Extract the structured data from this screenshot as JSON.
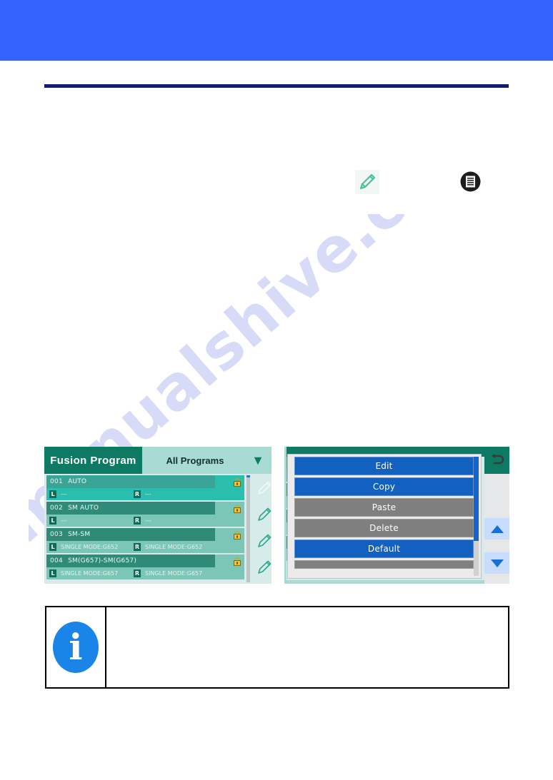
{
  "page": {
    "banner_color": "#3563fb",
    "rule_color": "#151a6e",
    "watermark": "manualshive.com"
  },
  "doc_icons": {
    "pencil": "pencil-edit-icon",
    "list": "list-document-icon"
  },
  "left_screen": {
    "title": "Fusion Program",
    "filter_label": "All Programs",
    "chevron": "▼",
    "back_icon": "back-arrow-icon",
    "scroll_up_icon": "▲",
    "scroll_down_icon": "▼",
    "rows": [
      {
        "number": "001",
        "name": "AUTO",
        "left_tag": "L",
        "left_value": "---",
        "right_tag": "R",
        "right_value": "---",
        "locked": true,
        "selected": true
      },
      {
        "number": "002",
        "name": "SM AUTO",
        "left_tag": "L",
        "left_value": "---",
        "right_tag": "R",
        "right_value": "---",
        "locked": true,
        "selected": false
      },
      {
        "number": "003",
        "name": "SM-SM",
        "left_tag": "L",
        "left_value": "SINGLE MODE:G652",
        "right_tag": "R",
        "right_value": "SINGLE MODE:G652",
        "locked": true,
        "selected": false
      },
      {
        "number": "004",
        "name": "SM(G657)-SM(G657)",
        "left_tag": "L",
        "left_value": "SINGLE MODE:G657",
        "right_tag": "R",
        "right_value": "SINGLE MODE:G657",
        "locked": true,
        "selected": false
      }
    ]
  },
  "right_screen": {
    "back_icon": "back-arrow-icon",
    "scroll_up_icon": "▲",
    "scroll_down_icon": "▼",
    "menu_items": [
      {
        "label": "Edit",
        "state": "enabled"
      },
      {
        "label": "Copy",
        "state": "enabled"
      },
      {
        "label": "Paste",
        "state": "disabled"
      },
      {
        "label": "Delete",
        "state": "disabled"
      },
      {
        "label": "Default",
        "state": "enabled"
      },
      {
        "label": "",
        "state": "disabled"
      }
    ]
  },
  "note": {
    "icon": "info-icon",
    "glyph": "i",
    "text": ""
  }
}
